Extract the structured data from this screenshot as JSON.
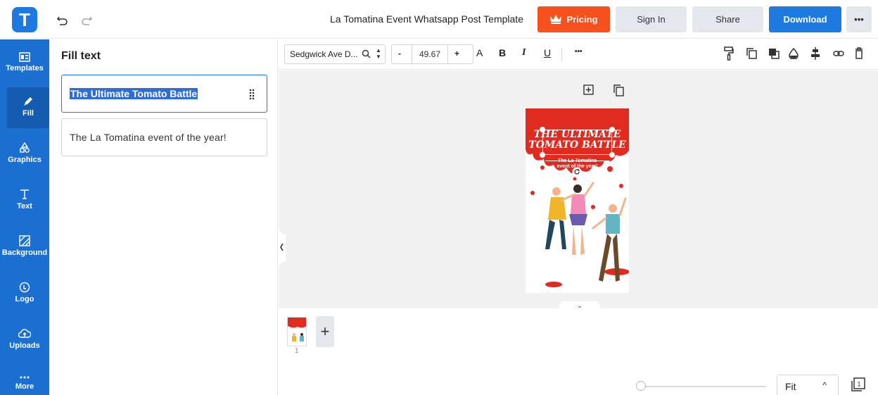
{
  "app": {
    "logo_letter": "T",
    "doc_title": "La Tomatina Event Whatsapp Post Template"
  },
  "header": {
    "pricing_label": "Pricing",
    "signin_label": "Sign In",
    "share_label": "Share",
    "download_label": "Download",
    "more_label": "•••"
  },
  "sidebar": {
    "items": [
      {
        "label": "Templates",
        "icon": "templates-icon"
      },
      {
        "label": "Fill",
        "icon": "pencil-icon"
      },
      {
        "label": "Graphics",
        "icon": "shapes-icon"
      },
      {
        "label": "Text",
        "icon": "text-icon"
      },
      {
        "label": "Background",
        "icon": "background-icon"
      },
      {
        "label": "Logo",
        "icon": "logo-icon"
      },
      {
        "label": "Uploads",
        "icon": "upload-cloud-icon"
      },
      {
        "label": "More",
        "icon": "more-icon"
      }
    ],
    "active": "Fill"
  },
  "panel": {
    "title": "Fill text",
    "fields": [
      {
        "value": "The Ultimate Tomato Battle",
        "selected": true
      },
      {
        "value": "The La Tomatina event of the year!",
        "selected": false
      }
    ]
  },
  "toolbar": {
    "font_name": "Sedgwick Ave D...",
    "font_size": "49.67",
    "minus": "-",
    "plus": "+",
    "case": "A",
    "bold": "B",
    "italic": "I",
    "underline": "U",
    "more": "•••"
  },
  "design": {
    "headline_line1": "THE ULTIMATE",
    "headline_line2": "TOMATO BATTLE",
    "subline": "The La Tomatina event of the year!",
    "accent_color": "#e02b20"
  },
  "pages": {
    "current": "1",
    "add": "+"
  },
  "zoom": {
    "value": "Fit",
    "caret": "^"
  },
  "colors": {
    "brand": "#1f7ae0",
    "pricing": "#f4511e",
    "sidebar": "#1b6fd1"
  }
}
